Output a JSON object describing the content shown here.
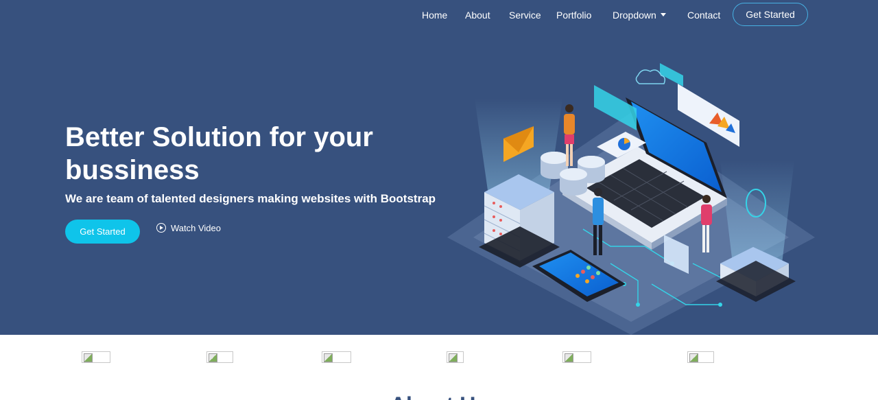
{
  "nav": {
    "items": [
      "Home",
      "About",
      "Service",
      "Portfolio",
      "Dropdown",
      "Contact"
    ],
    "cta": "Get Started"
  },
  "hero": {
    "title": "Better Solution for your bussiness",
    "subtitle": "We are team of talented designers making websites with Bootstrap",
    "primary_button": "Get Started",
    "video_link": "Watch Video",
    "illustration": "isometric-tech-illustration"
  },
  "clients": [
    "client-logo",
    "client-logo",
    "client-logo",
    "client-logo",
    "client-logo",
    "client-logo"
  ],
  "next_section": {
    "title": "About Us"
  },
  "colors": {
    "hero_bg": "#37517e",
    "accent": "#47b2e4",
    "button": "#0fc4ea"
  }
}
